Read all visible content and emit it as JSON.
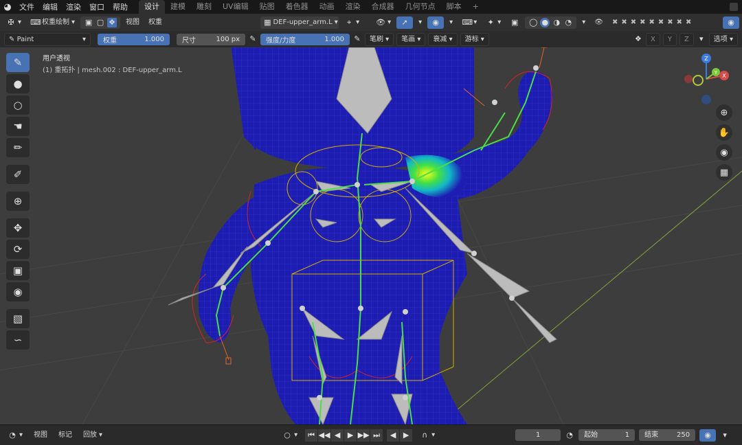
{
  "menu": {
    "items": [
      "文件",
      "编辑",
      "渲染",
      "窗口",
      "帮助"
    ],
    "workspaces": [
      "设计",
      "建模",
      "雕刻",
      "UV编辑",
      "贴图",
      "着色器",
      "动画",
      "渲染",
      "合成器",
      "几何节点",
      "脚本"
    ],
    "active_workspace": "设计",
    "add_tab": "+"
  },
  "header": {
    "mode": "权重绘制",
    "view": "视图",
    "weights": "权重",
    "active_group": "DEF-upper_arm.L"
  },
  "tool_settings": {
    "brush": "Paint",
    "weight_label": "权重",
    "weight_value": "1.000",
    "radius_label": "尺寸",
    "radius_value": "100 px",
    "strength_label": "强度/力度",
    "strength_value": "1.000",
    "brush_menu": "笔刷",
    "stroke_menu": "笔画",
    "falloff_menu": "衰减",
    "cursor_menu": "游标",
    "axes": [
      "X",
      "Y",
      "Z"
    ],
    "options": "选项"
  },
  "viewport": {
    "view_name": "用户透视",
    "object_info": "(1) 重拓扑 | mesh.002 : DEF-upper_arm.L",
    "gizmo_axes": [
      "X",
      "Y",
      "Z"
    ],
    "colors": {
      "background": "#3d3d3d",
      "mesh": "#1c1cb0",
      "bone": "#bdbdbd",
      "bone_line": "#4ade4a",
      "selection": "#ffb000"
    }
  },
  "timeline": {
    "view": "视图",
    "marker": "标记",
    "playback": "回放",
    "current_frame": "1",
    "start_label": "起始",
    "start_value": "1",
    "end_label": "结束",
    "end_value": "250"
  }
}
